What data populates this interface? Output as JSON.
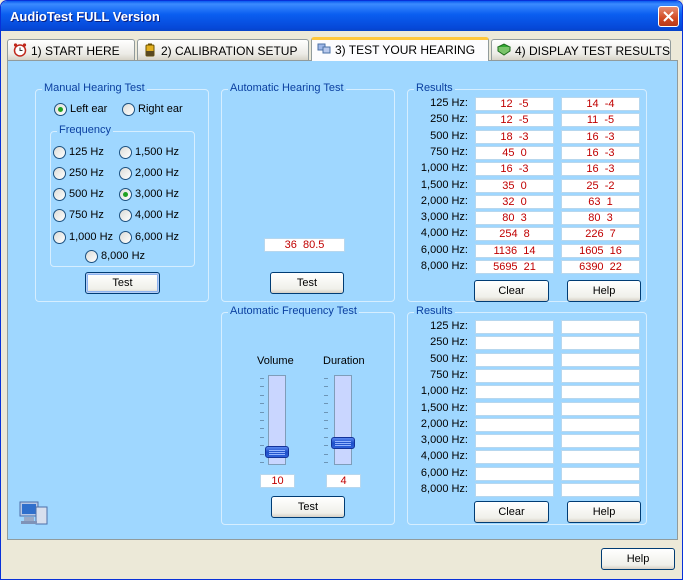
{
  "window": {
    "title": "AudioTest FULL Version"
  },
  "tabs": [
    {
      "label": "1) START HERE",
      "icon": "alarm-clock-icon"
    },
    {
      "label": "2) CALIBRATION SETUP",
      "icon": "battery-icon"
    },
    {
      "label": "3) TEST YOUR HEARING",
      "icon": "computers-icon",
      "active": true
    },
    {
      "label": "4) DISPLAY TEST RESULTS",
      "icon": "book-icon"
    }
  ],
  "manual": {
    "title": "Manual Hearing Test",
    "ears": [
      {
        "label": "Left ear",
        "selected": true
      },
      {
        "label": "Right ear",
        "selected": false
      }
    ],
    "frequency_title": "Frequency",
    "frequencies": [
      "125 Hz",
      "1,500 Hz",
      "250 Hz",
      "2,000 Hz",
      "500 Hz",
      "3,000 Hz",
      "750 Hz",
      "4,000 Hz",
      "1,000 Hz",
      "6,000 Hz",
      "8,000 Hz"
    ],
    "selected_frequency": "3,000 Hz",
    "test_label": "Test"
  },
  "automatic": {
    "title": "Automatic Hearing Test",
    "readout": "36  80.5",
    "test_label": "Test"
  },
  "results1": {
    "title": "Results",
    "rows": [
      {
        "freq": "125 Hz:",
        "left": "12  -5",
        "right": "14  -4"
      },
      {
        "freq": "250 Hz:",
        "left": "12  -5",
        "right": "11  -5"
      },
      {
        "freq": "500 Hz:",
        "left": "18  -3",
        "right": "16  -3"
      },
      {
        "freq": "750 Hz:",
        "left": "45  0",
        "right": "16  -3"
      },
      {
        "freq": "1,000 Hz:",
        "left": "16  -3",
        "right": "16  -3"
      },
      {
        "freq": "1,500 Hz:",
        "left": "35  0",
        "right": "25  -2"
      },
      {
        "freq": "2,000 Hz:",
        "left": "32  0",
        "right": "63  1"
      },
      {
        "freq": "3,000 Hz:",
        "left": "80  3",
        "right": "80  3"
      },
      {
        "freq": "4,000 Hz:",
        "left": "254  8",
        "right": "226  7"
      },
      {
        "freq": "6,000 Hz:",
        "left": "1136  14",
        "right": "1605  16"
      },
      {
        "freq": "8,000 Hz:",
        "left": "5695  21",
        "right": "6390  22"
      }
    ],
    "clear_label": "Clear",
    "help_label": "Help"
  },
  "freqtest": {
    "title": "Automatic Frequency Test",
    "volume_label": "Volume",
    "duration_label": "Duration",
    "volume_value": "10",
    "duration_value": "4",
    "volume_level": 0.1,
    "duration_level": 0.22,
    "test_label": "Test"
  },
  "results2": {
    "title": "Results",
    "rows": [
      {
        "freq": "125 Hz:",
        "left": "",
        "right": ""
      },
      {
        "freq": "250 Hz:",
        "left": "",
        "right": ""
      },
      {
        "freq": "500 Hz:",
        "left": "",
        "right": ""
      },
      {
        "freq": "750 Hz:",
        "left": "",
        "right": ""
      },
      {
        "freq": "1,000 Hz:",
        "left": "",
        "right": ""
      },
      {
        "freq": "1,500 Hz:",
        "left": "",
        "right": ""
      },
      {
        "freq": "2,000 Hz:",
        "left": "",
        "right": ""
      },
      {
        "freq": "3,000 Hz:",
        "left": "",
        "right": ""
      },
      {
        "freq": "4,000 Hz:",
        "left": "",
        "right": ""
      },
      {
        "freq": "6,000 Hz:",
        "left": "",
        "right": ""
      },
      {
        "freq": "8,000 Hz:",
        "left": "",
        "right": ""
      }
    ],
    "clear_label": "Clear",
    "help_label": "Help"
  },
  "footer": {
    "help_label": "Help"
  }
}
